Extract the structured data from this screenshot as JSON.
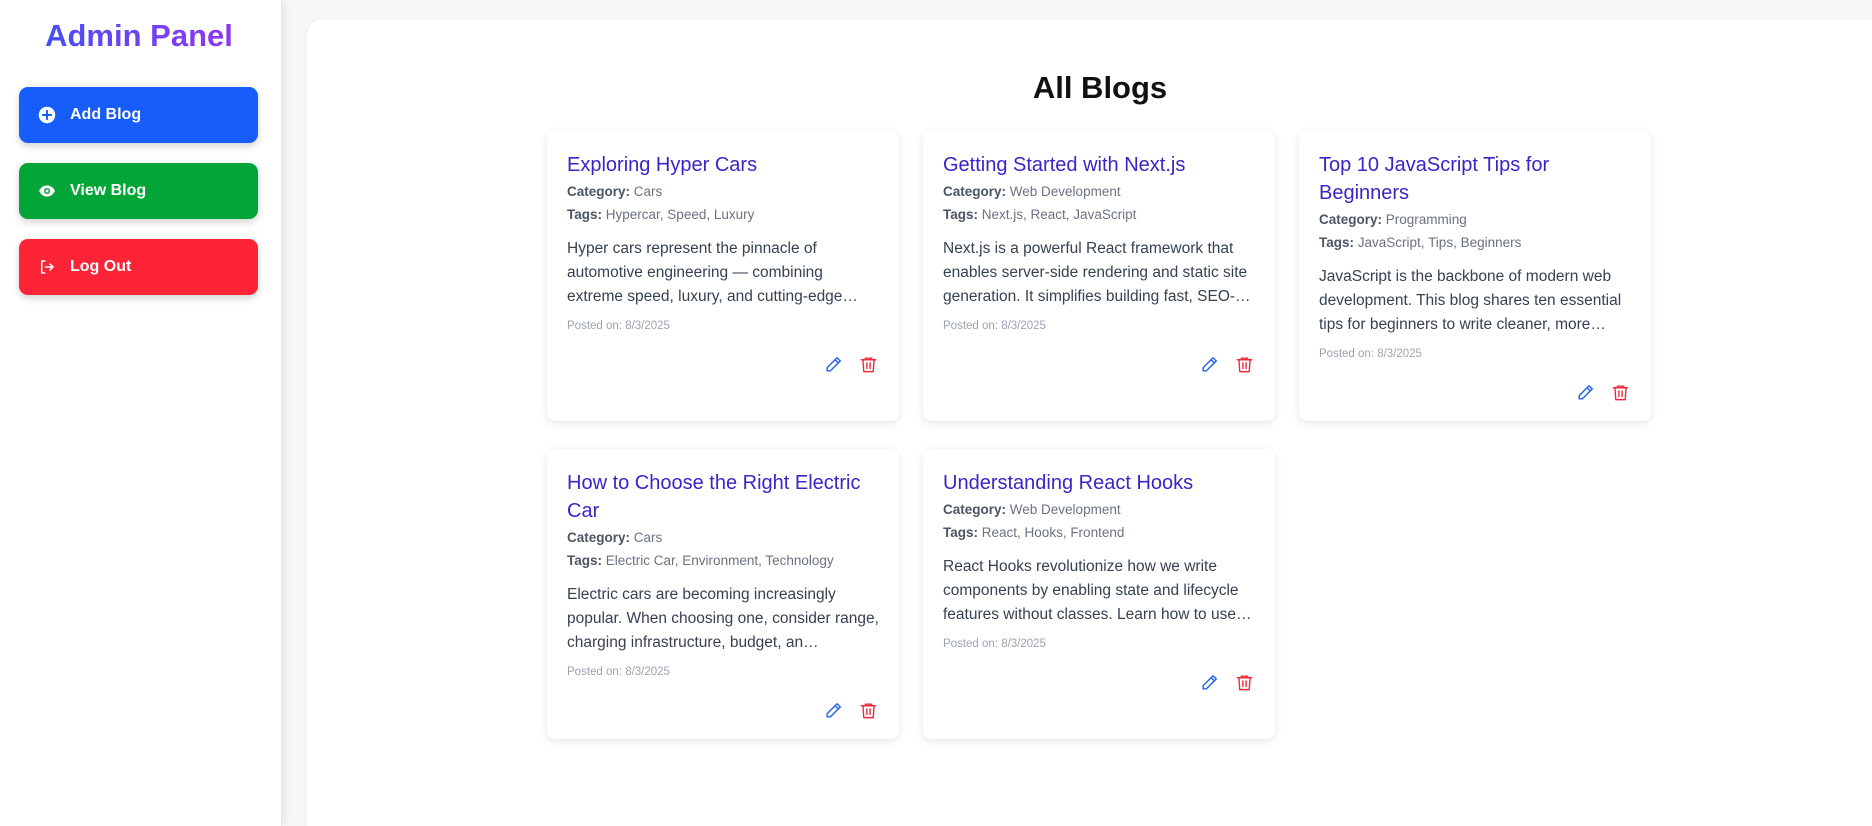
{
  "sidebar": {
    "title": "Admin Panel",
    "buttons": [
      {
        "label": "Add Blog",
        "icon": "plus-circle-icon",
        "color": "#165dfb"
      },
      {
        "label": "View Blog",
        "icon": "eye-icon",
        "color": "#02a538"
      },
      {
        "label": "Log Out",
        "icon": "logout-icon",
        "color": "#fd2438"
      }
    ]
  },
  "main": {
    "title": "All Blogs",
    "category_label": "Category:",
    "tags_label": "Tags:",
    "posted_label": "Posted on:",
    "blogs": [
      {
        "title": "Exploring Hyper Cars",
        "category": "Cars",
        "tags": "Hypercar, Speed, Luxury",
        "excerpt": "Hyper cars represent the pinnacle of automotive engineering — combining extreme speed, luxury, and cutting-edge…",
        "posted": "8/3/2025"
      },
      {
        "title": "Getting Started with Next.js",
        "category": "Web Development",
        "tags": "Next.js, React, JavaScript",
        "excerpt": "Next.js is a powerful React framework that enables server-side rendering and static site generation. It simplifies building fast, SEO-…",
        "posted": "8/3/2025"
      },
      {
        "title": "Top 10 JavaScript Tips for Beginners",
        "category": "Programming",
        "tags": "JavaScript, Tips, Beginners",
        "excerpt": "JavaScript is the backbone of modern web development. This blog shares ten essential tips for beginners to write cleaner, more…",
        "posted": "8/3/2025"
      },
      {
        "title": "How to Choose the Right Electric Car",
        "category": "Cars",
        "tags": "Electric Car, Environment, Technology",
        "excerpt": "Electric cars are becoming increasingly popular. When choosing one, consider range, charging infrastructure, budget, an…",
        "posted": "8/3/2025"
      },
      {
        "title": "Understanding React Hooks",
        "category": "Web Development",
        "tags": "React, Hooks, Frontend",
        "excerpt": "React Hooks revolutionize how we write components by enabling state and lifecycle features without classes. Learn how to use…",
        "posted": "8/3/2025"
      }
    ]
  },
  "colors": {
    "accent_title": "#3b24c8",
    "edit_icon": "#2563eb",
    "delete_icon": "#ef2b3b"
  }
}
